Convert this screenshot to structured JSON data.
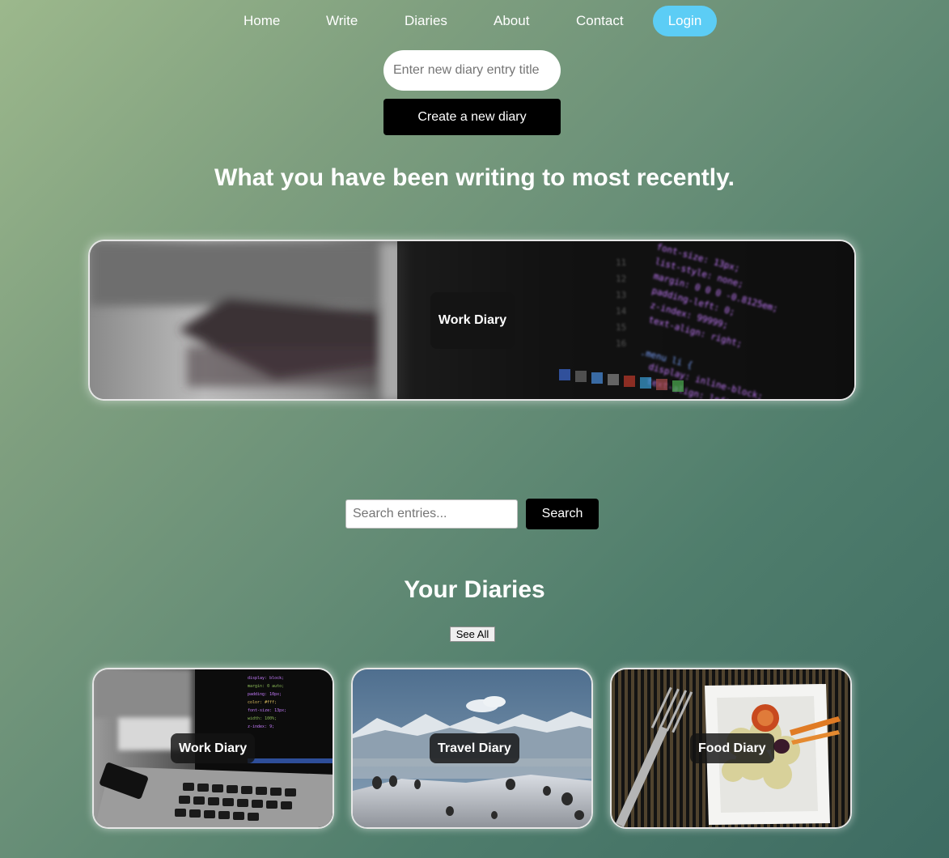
{
  "nav": {
    "items": [
      {
        "label": "Home"
      },
      {
        "label": "Write"
      },
      {
        "label": "Diaries"
      },
      {
        "label": "About"
      },
      {
        "label": "Contact"
      }
    ],
    "login_label": "Login",
    "login_color": "#5ccdf5"
  },
  "create": {
    "title_placeholder": "Enter new diary entry title",
    "title_value": "",
    "button_label": "Create a new diary"
  },
  "recent": {
    "heading": "What you have been writing to most recently.",
    "card": {
      "label": "Work Diary",
      "image": "laptop-code-photo"
    }
  },
  "search": {
    "placeholder": "Search entries...",
    "value": "",
    "button_label": "Search"
  },
  "diaries": {
    "heading": "Your Diaries",
    "see_all_label": "See All",
    "cards": [
      {
        "label": "Work Diary",
        "image": "laptop-code-photo"
      },
      {
        "label": "Travel Diary",
        "image": "snowy-mountains-photo"
      },
      {
        "label": "Food Diary",
        "image": "rice-plate-fork-photo"
      }
    ]
  }
}
